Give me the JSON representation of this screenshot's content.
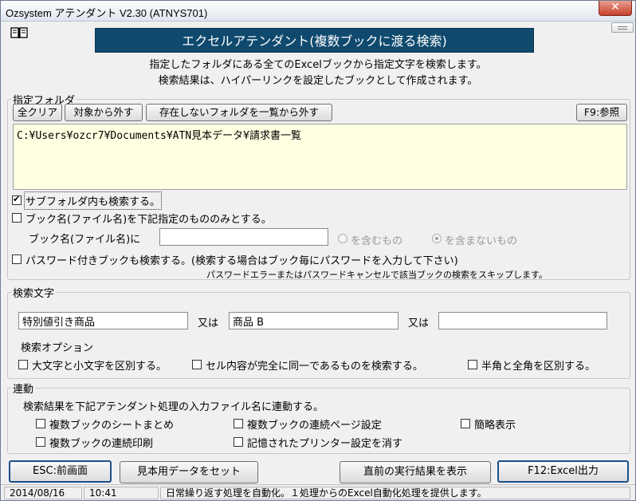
{
  "window": {
    "title": "Ozsystem アテンダント V2.30 (ATNYS701)",
    "close_glyph": "✕"
  },
  "banner": "エクセルアテンダント(複数ブックに渡る検索)",
  "description": {
    "line1": "指定したフォルダにある全てのExcelブックから指定文字を検索します。",
    "line2": "検索結果は、ハイパーリンクを設定したブックとして作成されます。"
  },
  "folder_group": {
    "legend": "指定フォルダ",
    "buttons": {
      "clear_all": "全クリア",
      "remove_target": "対象から外す",
      "remove_missing": "存在しないフォルダを一覧から外す",
      "browse": "F9:参照"
    },
    "folders": "C:¥Users¥ozcr7¥Documents¥ATN見本データ¥請求書一覧"
  },
  "options": {
    "subfolder": "サブフォルダ内も検索する。",
    "book_name_only": "ブック名(ファイル名)を下記指定のもののみとする。",
    "book_name_label": "ブック名(ファイル名)に",
    "book_name_value": "",
    "radio_contains": "を含むもの",
    "radio_not_contains": "を含まないもの",
    "password_books": "パスワード付きブックも検索する。(検索する場合はブック毎にパスワードを入力して下さい)",
    "password_note": "パスワードエラーまたはパスワードキャンセルで該当ブックの検索をスキップします。"
  },
  "search_group": {
    "legend": "検索文字",
    "term1": "特別値引き商品",
    "or1": "又は",
    "term2": "商品 B",
    "or2": "又は",
    "term3": "",
    "options_label": "検索オプション",
    "case_sensitive": "大文字と小文字を区別する。",
    "whole_cell": "セル内容が完全に同一であるものを検索する。",
    "width_sensitive": "半角と全角を区別する。"
  },
  "link_group": {
    "legend": "連動",
    "description": "検索結果を下記アテンダント処理の入力ファイル名に連動する。",
    "sheet_merge": "複数ブックのシートまとめ",
    "continuous_page": "複数ブックの連続ページ設定",
    "simple_view": "簡略表示",
    "continuous_print": "複数ブックの連続印刷",
    "clear_printer": "記憶されたプリンター設定を消す"
  },
  "bottom_buttons": {
    "back": "ESC:前画面",
    "sample_data": "見本用データをセット",
    "last_result": "直前の実行結果を表示",
    "excel_output": "F12:Excel出力"
  },
  "status": {
    "date": "2014/08/16",
    "time": "10:41",
    "message": "日常繰り返す処理を自動化。１処理からのExcel自動化処理を提供します。"
  },
  "colors": {
    "banner_bg": "#0f4a6e",
    "folder_list_bg": "#ffffe1"
  }
}
